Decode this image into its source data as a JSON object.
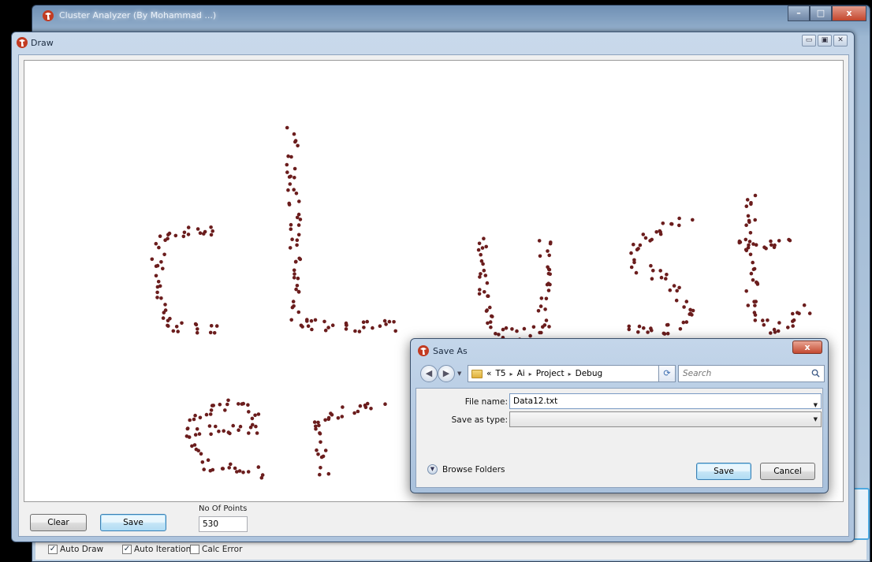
{
  "main_window": {
    "title": "Cluster Analyzer (By Mohammad ...)",
    "caption_buttons": [
      "–",
      "□",
      "x"
    ],
    "bottom_checks": [
      {
        "label": "Auto Draw",
        "checked": true
      },
      {
        "label": "Auto Iteration",
        "checked": true
      },
      {
        "label": "Calc Error",
        "checked": false
      }
    ]
  },
  "draw_window": {
    "title": "Draw",
    "caption_buttons": [
      "▭",
      "▣",
      "✕"
    ],
    "clear_label": "Clear",
    "save_label": "Save",
    "points_label": "No Of Points",
    "points_value": "530",
    "point_color": "#6b1d1d",
    "drawing_text": [
      "cLust",
      "er"
    ]
  },
  "save_dialog": {
    "title": "Save As",
    "close_label": "x",
    "path": [
      "«",
      "T5",
      "Ai",
      "Project",
      "Debug"
    ],
    "path_separator": "▸",
    "search_placeholder": "Search",
    "file_name_label": "File name:",
    "file_name_value": "Data12.txt",
    "save_type_label": "Save as type:",
    "save_type_value": "",
    "browse_folders_label": "Browse Folders",
    "save_label": "Save",
    "cancel_label": "Cancel"
  }
}
